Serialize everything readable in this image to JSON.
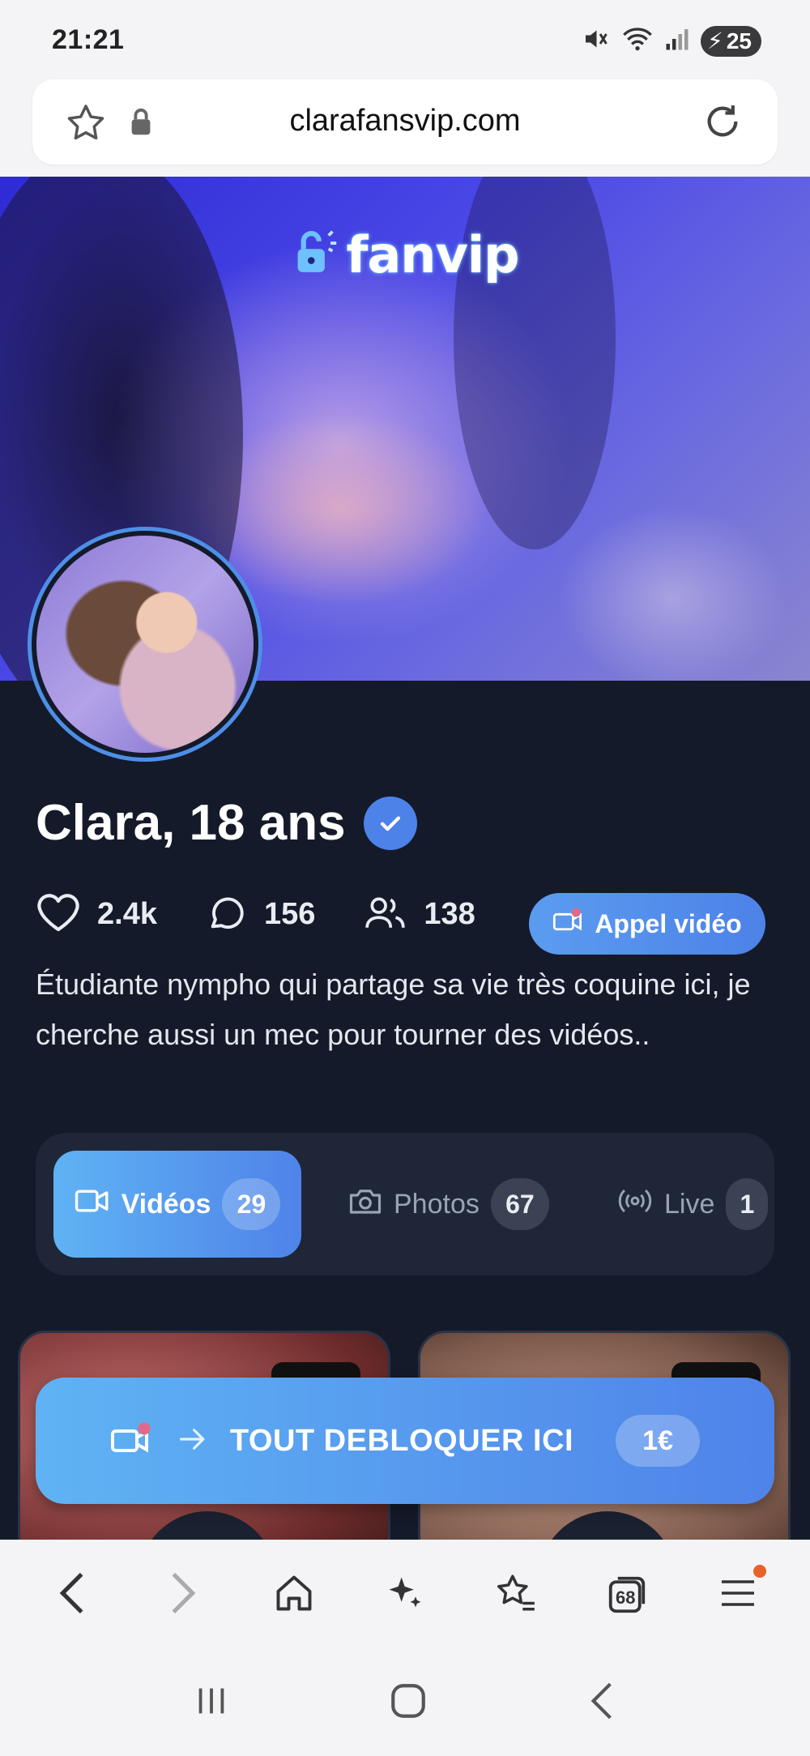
{
  "status_bar": {
    "time": "21:21",
    "battery": "25"
  },
  "url_bar": {
    "url": "clarafansvip.com"
  },
  "cover": {
    "brand": "fanvip"
  },
  "profile": {
    "call_button": "Appel vidéo",
    "name": "Clara, 18 ans",
    "stats": {
      "likes": "2.4k",
      "comments": "156",
      "followers": "138"
    },
    "bio": "Étudiante nympho qui partage sa vie très coquine ici, je cherche aussi un mec pour tourner des vidéos.."
  },
  "tabs": [
    {
      "label": "Vidéos",
      "count": "29"
    },
    {
      "label": "Photos",
      "count": "67"
    },
    {
      "label": "Live",
      "count": "1"
    }
  ],
  "unlock_banner": {
    "label": "TOUT DEBLOQUER ICI",
    "price": "1€"
  },
  "toolbar": {
    "tabs_count": "68"
  },
  "colors": {
    "accent": "#4f83e9",
    "page_bg": "#141a29",
    "online": "#3fbf55"
  }
}
